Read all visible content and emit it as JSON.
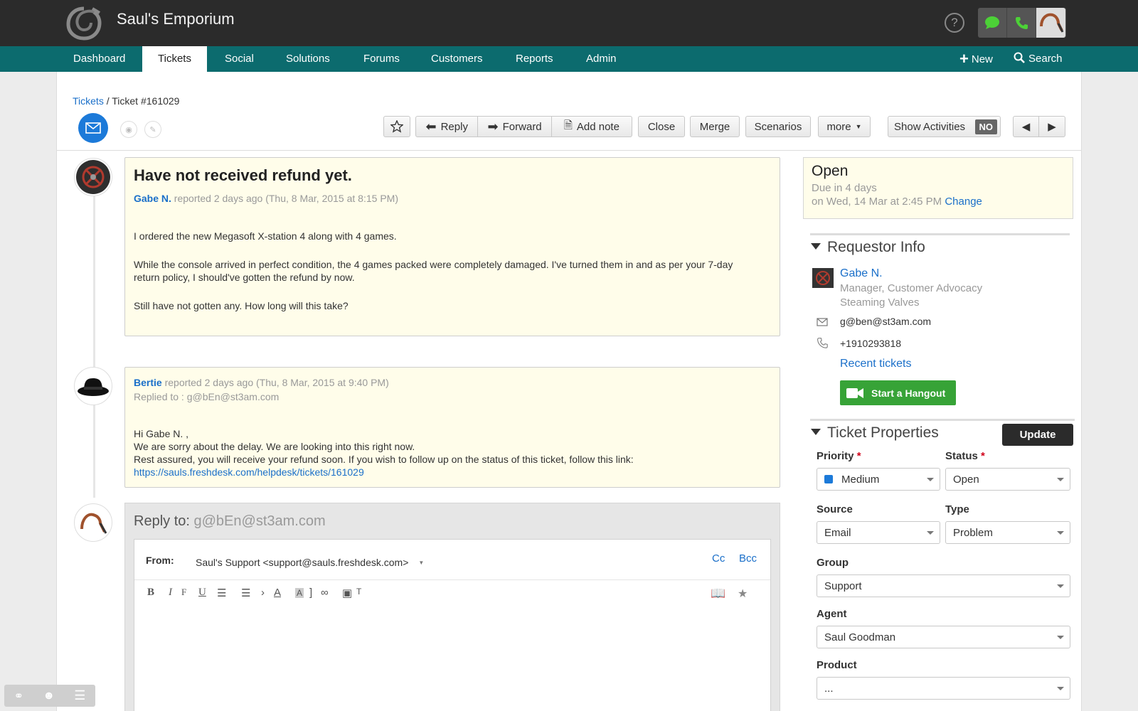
{
  "app": {
    "brand": "Saul's Emporium",
    "help": "?"
  },
  "nav": {
    "tabs": [
      "Dashboard",
      "Tickets",
      "Social",
      "Solutions",
      "Forums",
      "Customers",
      "Reports",
      "Admin"
    ],
    "new_label": "New",
    "search_label": "Search"
  },
  "breadcrumb": {
    "root": "Tickets",
    "sep": " / ",
    "current": "Ticket #161029"
  },
  "toolbar": {
    "reply": "Reply",
    "forward": "Forward",
    "add_note": "Add note",
    "close": "Close",
    "merge": "Merge",
    "scenarios": "Scenarios",
    "more": "more",
    "show_activities": "Show Activities",
    "show_activities_state": "NO"
  },
  "messages": [
    {
      "title": "Have not received refund yet.",
      "author": "Gabe N.",
      "meta": "reported 2 days ago (Thu, 8 Mar, 2015 at 8:15 PM)",
      "lines": [
        "I ordered the new Megasoft X-station 4 along with 4 games.",
        "While the console arrived in perfect condition, the 4 games packed were completely damaged. I've turned them in and as per your 7-day",
        "return policy, I should've gotten the refund by now.",
        "Still have not gotten any. How long will this take?"
      ]
    },
    {
      "author": "Bertie",
      "meta": "reported 2 days ago (Thu, 8 Mar, 2015 at 9:40 PM)",
      "replied_to": "Replied to : g@bEn@st3am.com",
      "lines": [
        "Hi Gabe N. ,",
        "We are sorry about the delay. We are looking into this right now.",
        "Rest assured, you will receive your refund soon. If you wish to follow up on the status of this ticket, follow this link:"
      ],
      "link": "https://sauls.freshdesk.com/helpdesk/tickets/161029"
    }
  ],
  "reply": {
    "label": "Reply to:",
    "to": "g@bEn@st3am.com",
    "from_label": "From:",
    "from_value": "Saul's Support <support@sauls.freshdesk.com>",
    "cc": "Cc",
    "bcc": "Bcc"
  },
  "status_box": {
    "status": "Open",
    "due": "Due in 4 days",
    "due_date": "on Wed, 14 Mar at 2:45 PM",
    "change": "Change"
  },
  "requestor": {
    "heading": "Requestor Info",
    "name": "Gabe N.",
    "title": "Manager, Customer Advocacy",
    "company": "Steaming Valves",
    "email": "g@ben@st3am.com",
    "phone": "+1910293818",
    "recent": "Recent tickets",
    "hangout": "Start a Hangout"
  },
  "properties": {
    "heading": "Ticket Properties",
    "update": "Update",
    "priority_label": "Priority",
    "priority": "Medium",
    "status_label": "Status",
    "status": "Open",
    "source_label": "Source",
    "source": "Email",
    "type_label": "Type",
    "type": "Problem",
    "group_label": "Group",
    "group": "Support",
    "agent_label": "Agent",
    "agent": "Saul Goodman",
    "product_label": "Product",
    "product": "...",
    "required_mark": "*"
  },
  "colors": {
    "nav": "#0c6b6e",
    "topbar": "#2b2b2b",
    "link": "#1a6fc9",
    "note_bg": "#fffdea",
    "hangout": "#37a337"
  }
}
